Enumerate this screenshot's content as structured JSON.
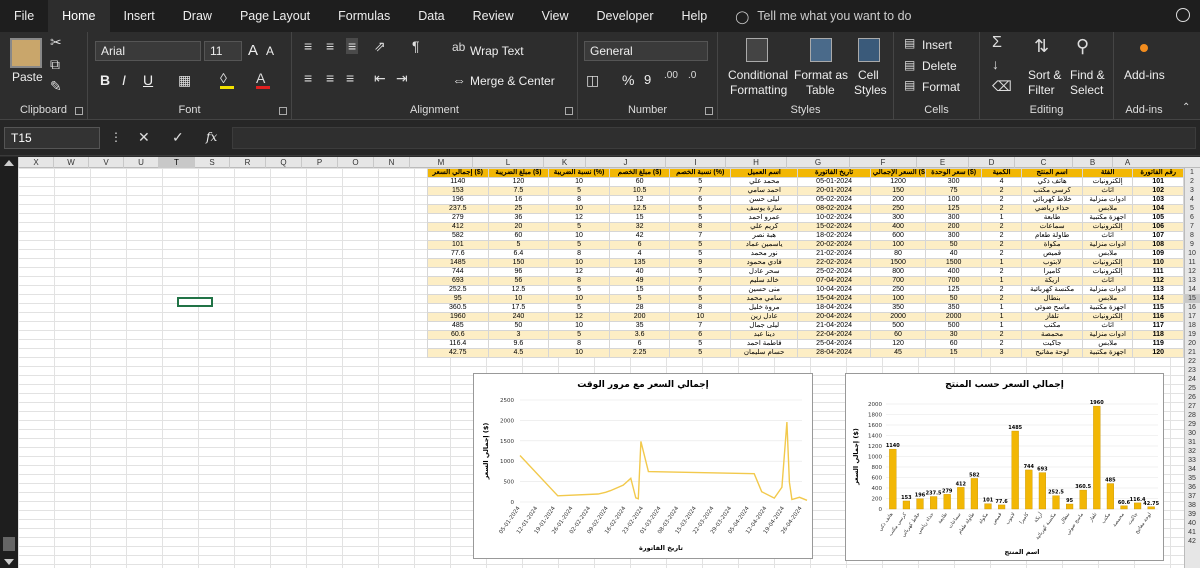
{
  "menu": [
    "File",
    "Home",
    "Insert",
    "Draw",
    "Page Layout",
    "Formulas",
    "Data",
    "Review",
    "View",
    "Developer",
    "Help"
  ],
  "tell_me": "Tell me what you want to do",
  "clipboard": {
    "paste": "Paste",
    "label": "Clipboard"
  },
  "font": {
    "name": "Arial",
    "size": "11",
    "label": "Font",
    "bold": "B",
    "italic": "I",
    "underline": "U",
    "grow": "A",
    "shrink": "A"
  },
  "alignment": {
    "wrap": "Wrap Text",
    "merge": "Merge & Center",
    "label": "Alignment"
  },
  "number": {
    "format": "General",
    "percent": "%",
    "comma": "9",
    "label": "Number"
  },
  "styles": {
    "cond": "Conditional",
    "cond2": "Formatting",
    "fmt": "Format as",
    "fmt2": "Table",
    "cell": "Cell",
    "cell2": "Styles",
    "label": "Styles"
  },
  "cells": {
    "insert": "Insert",
    "delete": "Delete",
    "format": "Format",
    "label": "Cells"
  },
  "editing": {
    "sort": "Sort &",
    "sort2": "Filter",
    "find": "Find &",
    "find2": "Select",
    "label": "Editing"
  },
  "addins": {
    "btn": "Add-ins",
    "label": "Add-ins"
  },
  "name_box": "T15",
  "fx": "fx",
  "columns": [
    "X",
    "W",
    "V",
    "U",
    "T",
    "S",
    "R",
    "Q",
    "P",
    "O",
    "N",
    "M",
    "L",
    "K",
    "J",
    "I",
    "H",
    "G",
    "F",
    "E",
    "D",
    "C",
    "B",
    "A"
  ],
  "rows": [
    "1",
    "2",
    "3",
    "4",
    "5",
    "6",
    "7",
    "8",
    "9",
    "10",
    "11",
    "12",
    "13",
    "14",
    "15",
    "16",
    "17",
    "18",
    "19",
    "20",
    "21",
    "22",
    "23",
    "24",
    "25",
    "26",
    "27",
    "28",
    "29",
    "30",
    "31",
    "32",
    "33",
    "34",
    "35",
    "36",
    "37",
    "38",
    "39",
    "40",
    "41",
    "42"
  ],
  "table": {
    "headers": [
      "إجمالي السعر ($)",
      "مبلغ الضريبة ($)",
      "نسبة الضريبة (%)",
      "مبلغ الخصم ($)",
      "نسبة الخصم (%)",
      "اسم العميل",
      "تاريخ الفاتورة",
      "السعر الإجمالي ($)",
      "سعر الوحدة ($)",
      "الكمية",
      "اسم المنتج",
      "الفئة",
      "رقم الفاتورة"
    ],
    "rows": [
      [
        "1140",
        "120",
        "10",
        "60",
        "5",
        "محمد علي",
        "05-01-2024",
        "1200",
        "300",
        "4",
        "هاتف ذكي",
        "إلكترونيات",
        "101"
      ],
      [
        "153",
        "7.5",
        "5",
        "10.5",
        "7",
        "أحمد سامي",
        "20-01-2024",
        "150",
        "75",
        "2",
        "كرسي مكتب",
        "أثاث",
        "102"
      ],
      [
        "196",
        "16",
        "8",
        "12",
        "6",
        "ليلى حسن",
        "05-02-2024",
        "200",
        "100",
        "2",
        "خلاط كهربائي",
        "أدوات منزلية",
        "103"
      ],
      [
        "237.5",
        "25",
        "10",
        "12.5",
        "5",
        "سارة يوسف",
        "08-02-2024",
        "250",
        "125",
        "2",
        "حذاء رياضي",
        "ملابس",
        "104"
      ],
      [
        "279",
        "36",
        "12",
        "15",
        "5",
        "عمرو أحمد",
        "10-02-2024",
        "300",
        "300",
        "1",
        "طابعة",
        "أجهزة مكتبية",
        "105"
      ],
      [
        "412",
        "20",
        "5",
        "32",
        "8",
        "كريم علي",
        "15-02-2024",
        "400",
        "200",
        "2",
        "سماعات",
        "إلكترونيات",
        "106"
      ],
      [
        "582",
        "60",
        "10",
        "42",
        "7",
        "هبة نصر",
        "18-02-2024",
        "600",
        "300",
        "2",
        "طاولة طعام",
        "أثاث",
        "107"
      ],
      [
        "101",
        "5",
        "5",
        "6",
        "5",
        "ياسمين عماد",
        "20-02-2024",
        "100",
        "50",
        "2",
        "مكواة",
        "أدوات منزلية",
        "108"
      ],
      [
        "77.6",
        "6.4",
        "8",
        "4",
        "5",
        "نور محمد",
        "21-02-2024",
        "80",
        "40",
        "2",
        "قميص",
        "ملابس",
        "109"
      ],
      [
        "1485",
        "150",
        "10",
        "135",
        "9",
        "فادي محمود",
        "22-02-2024",
        "1500",
        "1500",
        "1",
        "لابتوب",
        "إلكترونيات",
        "110"
      ],
      [
        "744",
        "96",
        "12",
        "40",
        "5",
        "سحر عادل",
        "25-02-2024",
        "800",
        "400",
        "2",
        "كاميرا",
        "إلكترونيات",
        "111"
      ],
      [
        "693",
        "56",
        "8",
        "49",
        "7",
        "خالد سليم",
        "07-04-2024",
        "700",
        "700",
        "1",
        "أريكة",
        "أثاث",
        "112"
      ],
      [
        "252.5",
        "12.5",
        "5",
        "15",
        "6",
        "منى حسين",
        "10-04-2024",
        "250",
        "125",
        "2",
        "مكنسة كهربائية",
        "أدوات منزلية",
        "113"
      ],
      [
        "95",
        "10",
        "10",
        "5",
        "5",
        "سامي محمد",
        "15-04-2024",
        "100",
        "50",
        "2",
        "بنطال",
        "ملابس",
        "114"
      ],
      [
        "360.5",
        "17.5",
        "5",
        "28",
        "8",
        "مروة خليل",
        "18-04-2024",
        "350",
        "350",
        "1",
        "ماسح ضوئي",
        "أجهزة مكتبية",
        "115"
      ],
      [
        "1960",
        "240",
        "12",
        "200",
        "10",
        "عادل زين",
        "20-04-2024",
        "2000",
        "2000",
        "1",
        "تلفاز",
        "إلكترونيات",
        "116"
      ],
      [
        "485",
        "50",
        "10",
        "35",
        "7",
        "ليلى جمال",
        "21-04-2024",
        "500",
        "500",
        "1",
        "مكتب",
        "أثاث",
        "117"
      ],
      [
        "60.6",
        "3",
        "5",
        "3.6",
        "6",
        "دينا عبد",
        "22-04-2024",
        "60",
        "30",
        "2",
        "محمصة",
        "أدوات منزلية",
        "118"
      ],
      [
        "116.4",
        "9.6",
        "8",
        "6",
        "5",
        "فاطمة أحمد",
        "25-04-2024",
        "120",
        "60",
        "2",
        "جاكيت",
        "ملابس",
        "119"
      ],
      [
        "42.75",
        "4.5",
        "10",
        "2.25",
        "5",
        "حسام سليمان",
        "28-04-2024",
        "45",
        "15",
        "3",
        "لوحة مفاتيح",
        "أجهزة مكتبية",
        "120"
      ]
    ]
  },
  "chart_data": [
    {
      "type": "line",
      "title": "إجمالي السعر مع مرور الوقت",
      "xlabel": "تاريخ الفاتورة",
      "ylabel": "إجمالي السعر ($)",
      "ylim": [
        0,
        2500
      ],
      "yticks": [
        "0",
        "500",
        "1000",
        "1500",
        "2000",
        "2500"
      ],
      "xticks": [
        "05-01-2024",
        "12-01-2024",
        "19-01-2024",
        "26-01-2024",
        "02-02-2024",
        "09-02-2024",
        "16-02-2024",
        "23-02-2024",
        "01-03-2024",
        "08-03-2024",
        "15-03-2024",
        "22-03-2024",
        "29-03-2024",
        "05-04-2024",
        "12-04-2024",
        "19-04-2024",
        "26-04-2024"
      ],
      "x": [
        "05-01-2024",
        "20-01-2024",
        "05-02-2024",
        "08-02-2024",
        "10-02-2024",
        "15-02-2024",
        "18-02-2024",
        "20-02-2024",
        "21-02-2024",
        "22-02-2024",
        "25-02-2024",
        "07-04-2024",
        "10-04-2024",
        "15-04-2024",
        "18-04-2024",
        "20-04-2024",
        "21-04-2024",
        "22-04-2024",
        "25-04-2024",
        "28-04-2024"
      ],
      "values": [
        1140,
        153,
        196,
        237.5,
        279,
        412,
        582,
        101,
        77.6,
        1485,
        744,
        693,
        252.5,
        95,
        360.5,
        1960,
        485,
        60.6,
        116.4,
        42.75
      ],
      "color": "#f2c94c"
    },
    {
      "type": "bar",
      "title": "إجمالي السعر حسب المنتج",
      "xlabel": "اسم المنتج",
      "ylabel": "إجمالي السعر ($)",
      "ylim": [
        0,
        2000
      ],
      "yticks": [
        "0",
        "200",
        "400",
        "600",
        "800",
        "1000",
        "1200",
        "1400",
        "1600",
        "1800",
        "2000"
      ],
      "categories": [
        "هاتف ذكي",
        "كرسي مكتب",
        "خلاط كهربائي",
        "حذاء رياضي",
        "طابعة",
        "سماعات",
        "طاولة طعام",
        "مكواة",
        "قميص",
        "لابتوب",
        "كاميرا",
        "أريكة",
        "مكنسة كهربائية",
        "بنطال",
        "ماسح ضوئي",
        "تلفاز",
        "مكتب",
        "محمصة",
        "جاكيت",
        "لوحة مفاتيح"
      ],
      "values": [
        1140,
        153,
        196,
        237.5,
        279,
        412,
        582,
        101,
        77.6,
        1485,
        744,
        693,
        252.5,
        95,
        360.5,
        1960,
        485,
        60.6,
        116.4,
        42.75
      ],
      "labels": [
        "1140",
        "153",
        "196",
        "237.5",
        "279",
        "412",
        "582",
        "101",
        "77.6",
        "1485",
        "744",
        "693",
        "252.5",
        "95",
        "360.5",
        "1960",
        "485",
        "60.6",
        "116.4",
        "42.75"
      ],
      "color": "#f2b705"
    }
  ]
}
